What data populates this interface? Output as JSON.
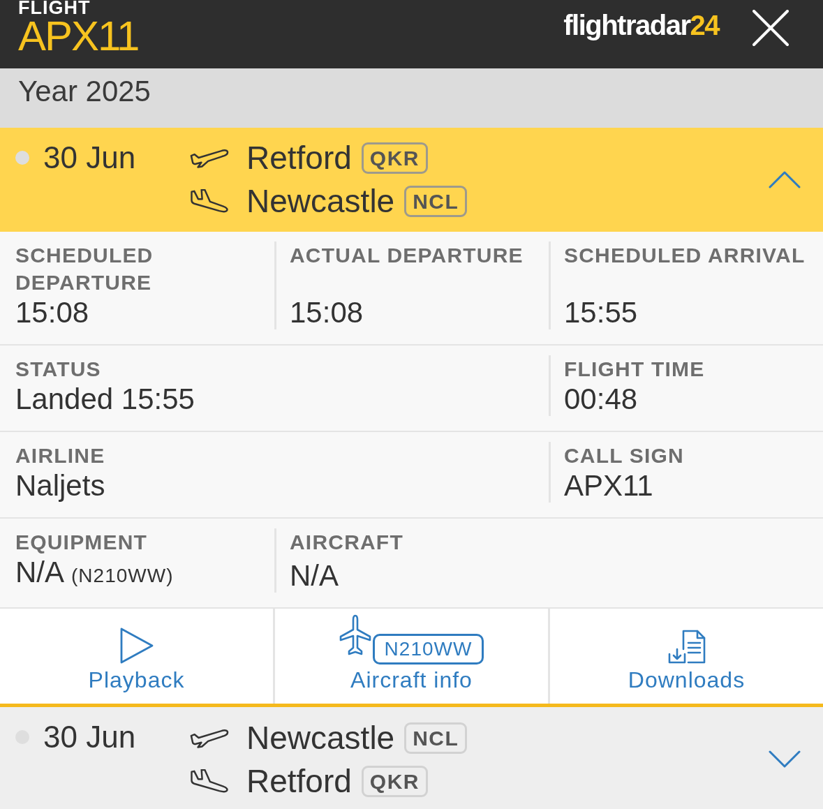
{
  "header": {
    "label": "FLIGHT",
    "flight_number": "APX11",
    "logo": {
      "wordmark": "flightradar",
      "number": "24"
    }
  },
  "year_bar": {
    "text": "Year 2025"
  },
  "flights": [
    {
      "date": "30 Jun",
      "expanded": true,
      "departure": {
        "city": "Retford",
        "code": "QKR"
      },
      "arrival": {
        "city": "Newcastle",
        "code": "NCL"
      },
      "details": [
        {
          "cells": [
            {
              "label": "SCHEDULED DEPARTURE",
              "value": "15:08",
              "wide": false
            },
            {
              "label": "ACTUAL DEPARTURE",
              "value": "15:08",
              "wide": false
            },
            {
              "label": "SCHEDULED ARRIVAL",
              "value": "15:55",
              "wide": false
            }
          ]
        },
        {
          "cells": [
            {
              "label": "STATUS",
              "value": "Landed 15:55",
              "wide": true
            },
            {
              "label": "FLIGHT TIME",
              "value": "00:48",
              "wide": false
            }
          ]
        },
        {
          "cells": [
            {
              "label": "AIRLINE",
              "value": "Naljets",
              "wide": true
            },
            {
              "label": "CALL SIGN",
              "value": "APX11",
              "wide": false
            }
          ]
        },
        {
          "cells": [
            {
              "label": "EQUIPMENT",
              "value": "N/A",
              "note": "(N210WW)",
              "wide": false
            },
            {
              "label": "AIRCRAFT",
              "value": "N/A",
              "wide": true
            }
          ]
        }
      ],
      "actions": [
        {
          "kind": "playback",
          "label": "Playback"
        },
        {
          "kind": "aircraft",
          "label": "Aircraft info",
          "registration": "N210WW"
        },
        {
          "kind": "downloads",
          "label": "Downloads"
        }
      ]
    },
    {
      "date": "30 Jun",
      "expanded": false,
      "departure": {
        "city": "Newcastle",
        "code": "NCL"
      },
      "arrival": {
        "city": "Retford",
        "code": "QKR"
      }
    }
  ]
}
